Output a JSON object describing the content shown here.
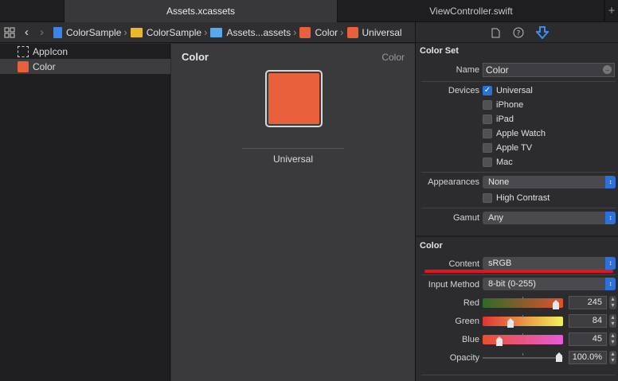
{
  "tabs": {
    "assets": "Assets.xcassets",
    "viewcontroller": "ViewController.swift",
    "add": "+"
  },
  "jumpbar": {
    "items": [
      "ColorSample",
      "ColorSample",
      "Assets...assets",
      "Color",
      "Universal"
    ]
  },
  "navigator": {
    "items": [
      "AppIcon",
      "Color"
    ]
  },
  "editor": {
    "title": "Color",
    "right_label": "Color",
    "swatch_label": "Universal",
    "swatch_color": "#e8603c"
  },
  "inspector": {
    "color_set_header": "Color Set",
    "name_label": "Name",
    "name_value": "Color",
    "devices_label": "Devices",
    "devices": [
      {
        "label": "Universal",
        "checked": true
      },
      {
        "label": "iPhone",
        "checked": false
      },
      {
        "label": "iPad",
        "checked": false
      },
      {
        "label": "Apple Watch",
        "checked": false
      },
      {
        "label": "Apple TV",
        "checked": false
      },
      {
        "label": "Mac",
        "checked": false
      }
    ],
    "appearances_label": "Appearances",
    "appearances_value": "None",
    "high_contrast_label": "High Contrast",
    "gamut_label": "Gamut",
    "gamut_value": "Any",
    "color_header": "Color",
    "content_label": "Content",
    "content_value": "sRGB",
    "input_method_label": "Input Method",
    "input_method_value": "8-bit (0-255)",
    "red_label": "Red",
    "red_value": "245",
    "green_label": "Green",
    "green_value": "84",
    "blue_label": "Blue",
    "blue_value": "45",
    "opacity_label": "Opacity",
    "opacity_value": "100.0%",
    "red_level": 0.96,
    "green_level": 0.33,
    "blue_level": 0.18,
    "opacity_level": 1.0
  },
  "colors": {
    "accent": "#2f6fd8",
    "swatch": "#e8603c",
    "highlight": "#e8141c"
  }
}
